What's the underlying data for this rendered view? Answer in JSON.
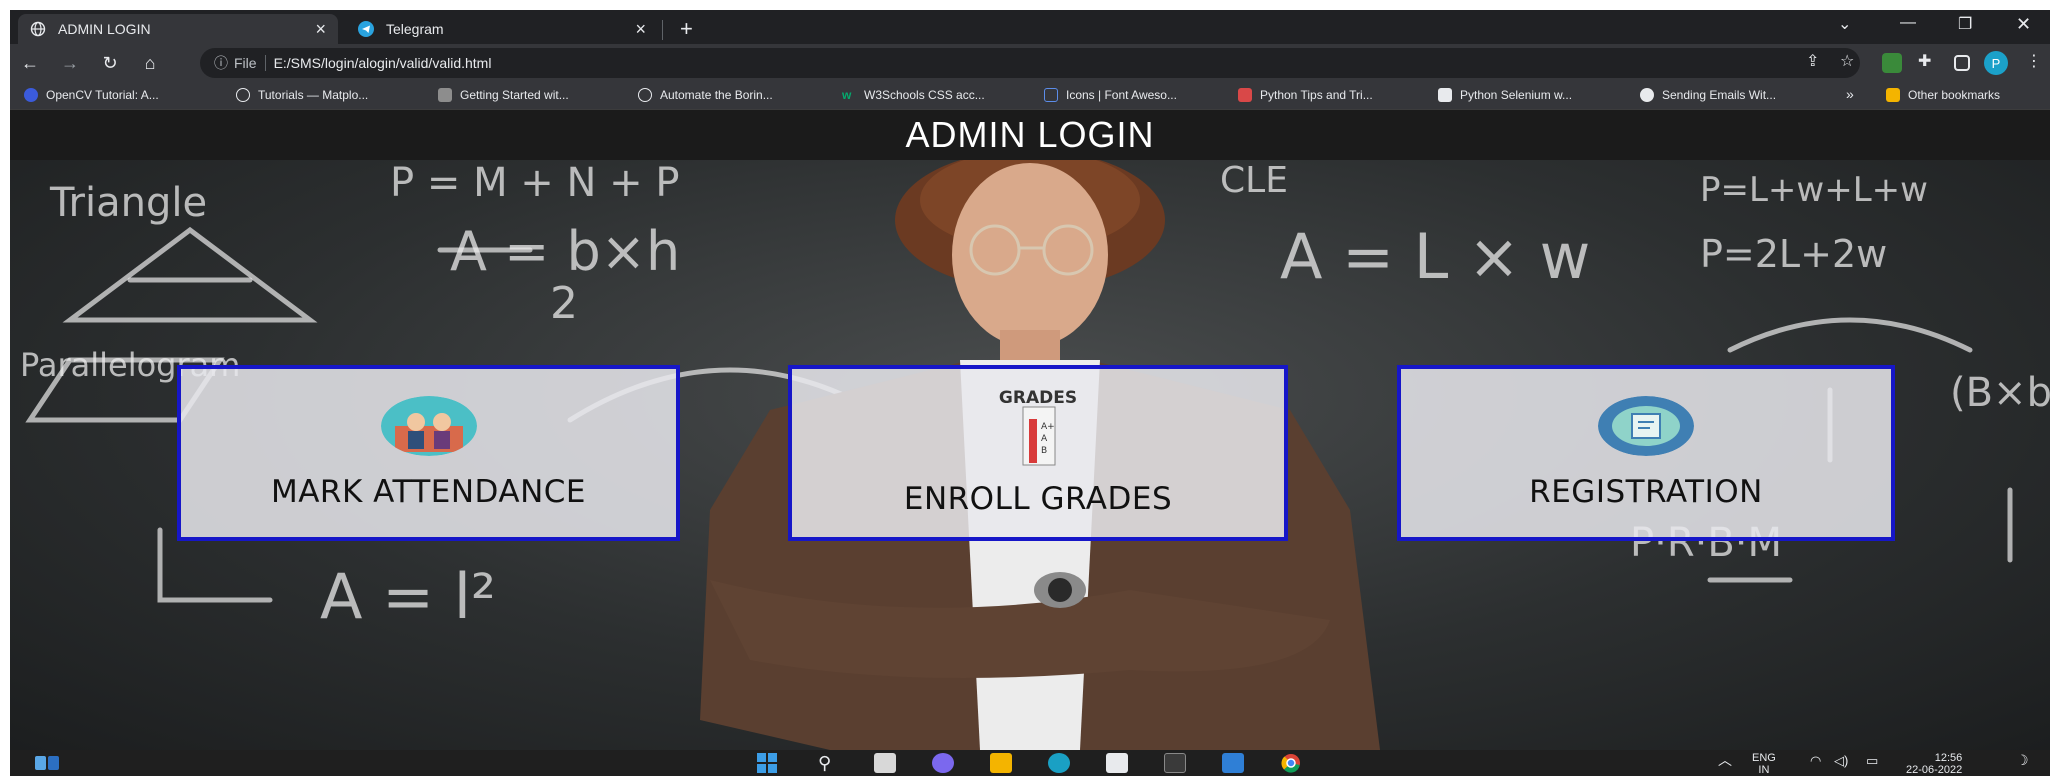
{
  "browser": {
    "tabs": [
      {
        "title": "ADMIN LOGIN",
        "active": true,
        "icon": "globe-icon"
      },
      {
        "title": "Telegram",
        "active": false,
        "icon": "telegram-icon"
      }
    ],
    "address": {
      "info_label": "File",
      "url": "E:/SMS/login/alogin/valid/valid.html"
    },
    "bookmarks": [
      "OpenCV Tutorial: A...",
      "Tutorials — Matplo...",
      "Getting Started wit...",
      "Automate the Borin...",
      "W3Schools CSS acc...",
      "Icons | Font Aweso...",
      "Python Tips and Tri...",
      "Python Selenium w...",
      "Sending Emails Wit..."
    ],
    "bookmarks_overflow": "»",
    "other_bookmarks": "Other bookmarks",
    "profile_initial": "P"
  },
  "page": {
    "title": "ADMIN LOGIN",
    "cards": [
      {
        "label": "MARK ATTENDANCE",
        "icon": "attendance-image"
      },
      {
        "label": "ENROLL GRADES",
        "icon": "grades-image",
        "image_text": "GRADES"
      },
      {
        "label": "REGISTRATION",
        "icon": "registration-image"
      }
    ]
  },
  "taskbar": {
    "language": "ENG",
    "region": "IN",
    "time": "12:56",
    "date": "22-06-2022"
  },
  "colors": {
    "card_border": "#1616c8",
    "header_bg": "#1b1b1b",
    "chrome_bg": "#202124"
  }
}
